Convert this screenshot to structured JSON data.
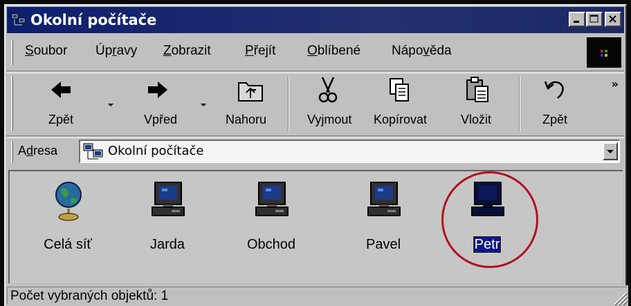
{
  "window": {
    "title": "Okolní počítače"
  },
  "menu": {
    "items": [
      {
        "label": "Soubor",
        "accel": "S",
        "rest": "oubor"
      },
      {
        "label": "Úpravy",
        "pre": "Úp",
        "accel": "r",
        "rest": "avy"
      },
      {
        "label": "Zobrazit",
        "accel": "Z",
        "rest": "obrazit"
      },
      {
        "label": "Přejít",
        "accel": "P",
        "rest": "řejít"
      },
      {
        "label": "Oblíbené",
        "accel": "O",
        "rest": "blíbené"
      },
      {
        "label": "Nápověda",
        "pre": "Nápo",
        "accel": "v",
        "rest": "ěda"
      }
    ]
  },
  "toolbar": {
    "back_label": "Zpět",
    "forward_label": "Vpřed",
    "up_label": "Nahoru",
    "cut_label": "Vyjmout",
    "copy_label": "Kopírovat",
    "paste_label": "Vložit",
    "undo_label": "Zpět",
    "more_label": "»"
  },
  "address": {
    "label": "Adresa",
    "label_accel": "d",
    "value": "Okolní počítače"
  },
  "items": [
    {
      "label": "Celá síť",
      "icon": "globe-icon"
    },
    {
      "label": "Jarda",
      "icon": "computer-icon"
    },
    {
      "label": "Obchod",
      "icon": "computer-icon"
    },
    {
      "label": "Pavel",
      "icon": "computer-icon"
    },
    {
      "label": "Petr",
      "icon": "computer-icon",
      "selected": true
    }
  ],
  "status": {
    "text": "Počet vybraných objektů: 1"
  },
  "colors": {
    "titlebar": "#0c1f6e",
    "face": "#c0c0c0",
    "selection": "#10188a",
    "highlight_circle": "#b01020"
  }
}
